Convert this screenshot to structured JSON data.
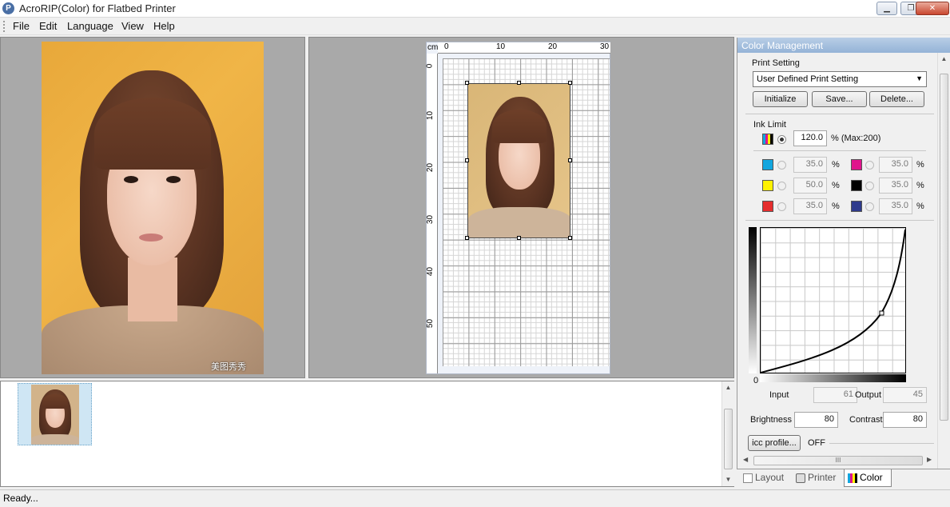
{
  "window": {
    "title": "AcroRIP(Color) for Flatbed Printer",
    "app_icon": "P"
  },
  "menu": [
    {
      "label": "File"
    },
    {
      "label": "Edit"
    },
    {
      "label": "Language"
    },
    {
      "label": "View"
    },
    {
      "label": "Help"
    }
  ],
  "preview": {
    "watermark": "美图秀秀"
  },
  "layout": {
    "ruler_unit": "cm",
    "top_ticks": [
      "0",
      "10",
      "20",
      "30"
    ],
    "left_ticks": [
      "0",
      "10",
      "20",
      "30",
      "40",
      "50"
    ]
  },
  "panel": {
    "title": "Color Management",
    "print_setting_label": "Print Setting",
    "print_setting_value": "User Defined Print Setting",
    "buttons": {
      "initialize": "Initialize",
      "save": "Save...",
      "delete": "Delete..."
    },
    "ink_limit_label": "Ink Limit",
    "ink_limit_value": "120.0",
    "ink_limit_max": "% (Max:200)",
    "percent": "%",
    "channels": [
      {
        "name": "cyan",
        "color": "#12a6df",
        "value": "35.0"
      },
      {
        "name": "magenta",
        "color": "#e0148c",
        "value": "35.0"
      },
      {
        "name": "yellow",
        "color": "#fff200",
        "value": "50.0"
      },
      {
        "name": "black",
        "color": "#000000",
        "value": "35.0"
      },
      {
        "name": "red",
        "color": "#e52d2d",
        "value": "35.0"
      },
      {
        "name": "blue",
        "color": "#2e3a8c",
        "value": "35.0"
      }
    ],
    "curve_origin_label": "0",
    "input_label": "Input",
    "input_value": "61",
    "output_label": "Output",
    "output_value": "45",
    "brightness_label": "Brightness",
    "brightness_value": "80",
    "contrast_label": "Contrast",
    "contrast_value": "80",
    "icc_button": "icc profile...",
    "icc_state": "OFF",
    "hscroll_grip": "III"
  },
  "tabs": [
    {
      "label": "Layout",
      "active": false
    },
    {
      "label": "Printer",
      "active": false
    },
    {
      "label": "Color",
      "active": true
    }
  ],
  "status": {
    "text": "Ready..."
  }
}
